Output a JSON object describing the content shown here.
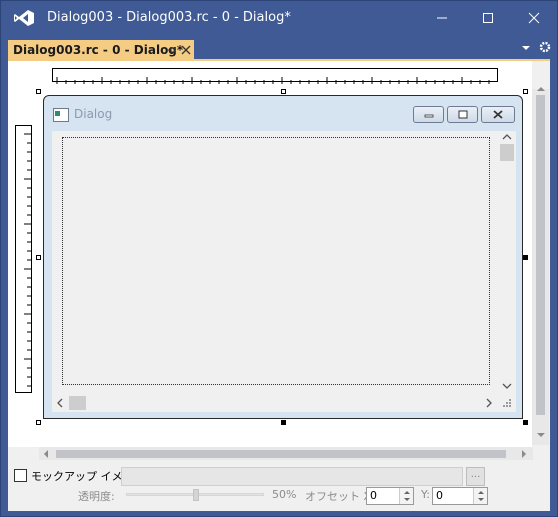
{
  "window": {
    "title": "Dialog003 - Dialog003.rc - 0 - Dialog*"
  },
  "tab": {
    "label": "Dialog003.rc - 0 - Dialog*"
  },
  "dialog": {
    "title": "Dialog"
  },
  "mockup": {
    "checkbox_label": "モックアップ イメージ",
    "checked": false,
    "path_value": "",
    "browse_label": "...",
    "opacity_label": "透明度:",
    "opacity_value": "50%",
    "opacity_fraction": 0.5,
    "offset_label": "オフセット X:",
    "offset_x": "0",
    "y_label": "Y:",
    "offset_y": "0"
  },
  "colors": {
    "title_bar": "#3f5a94",
    "tab_accent": "#f5cc84",
    "dialog_frame": "#d6e3f1"
  }
}
